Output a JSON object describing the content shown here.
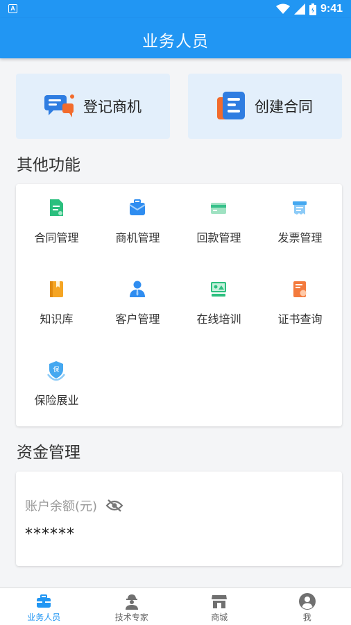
{
  "status_bar": {
    "time": "9:41",
    "app_badge": "A"
  },
  "header": {
    "title": "业务人员"
  },
  "quick_actions": [
    {
      "label": "登记商机",
      "icon": "chat-bubbles-icon"
    },
    {
      "label": "创建合同",
      "icon": "contract-document-icon"
    }
  ],
  "sections": {
    "other_functions": "其他功能",
    "fund_management": "资金管理"
  },
  "functions": [
    {
      "label": "合同管理",
      "icon": "contract-icon",
      "color": "#2bbf7e"
    },
    {
      "label": "商机管理",
      "icon": "briefcase-icon",
      "color": "#2f8df0"
    },
    {
      "label": "回款管理",
      "icon": "payment-card-icon",
      "color": "#36c08a"
    },
    {
      "label": "发票管理",
      "icon": "invoice-icon",
      "color": "#45a8f0"
    },
    {
      "label": "知识库",
      "icon": "book-icon",
      "color": "#f5a524"
    },
    {
      "label": "客户管理",
      "icon": "customer-icon",
      "color": "#2f8df0"
    },
    {
      "label": "在线培训",
      "icon": "training-screen-icon",
      "color": "#2bbf7e"
    },
    {
      "label": "证书查询",
      "icon": "certificate-icon",
      "color": "#f37a3d"
    },
    {
      "label": "保险展业",
      "icon": "insurance-shield-icon",
      "color": "#45a8f0"
    }
  ],
  "fund": {
    "balance_label": "账户余额(元)",
    "balance_value": "******",
    "visibility": "hidden"
  },
  "tabs": [
    {
      "label": "业务人员",
      "icon": "briefcase-icon",
      "active": true
    },
    {
      "label": "技术专家",
      "icon": "engineer-icon",
      "active": false
    },
    {
      "label": "商城",
      "icon": "store-icon",
      "active": false
    },
    {
      "label": "我",
      "icon": "user-icon",
      "active": false
    }
  ],
  "colors": {
    "primary": "#2196f3",
    "quick_bg": "#e3effb",
    "page_bg": "#f4f5f7"
  }
}
